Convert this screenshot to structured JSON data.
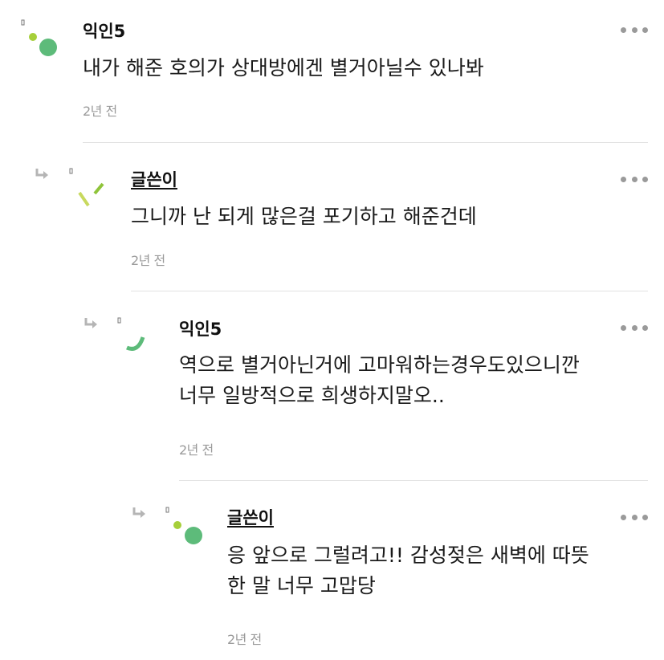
{
  "colors": {
    "accent_green": "#5dbb7a",
    "lime": "#a6cf3a",
    "text_primary": "#1a1a1a",
    "text_secondary": "#9a9a9a",
    "divider": "#e2e2e2"
  },
  "comments": [
    {
      "author": "익인5",
      "text": "내가 해준 호의가 상대방에겐 별거아닐수 있나봐",
      "time": "2년 전",
      "is_reply": false,
      "is_op": false,
      "avatar_icon": "dot-circle-avatar-icon"
    },
    {
      "author": "글쓴이",
      "text": "그니까 난 되게 많은걸 포기하고 해준건데",
      "time": "2년 전",
      "is_reply": true,
      "is_op": true,
      "avatar_icon": "slash-lines-avatar-icon"
    },
    {
      "author": "익인5",
      "text": "역으로 별거아닌거에 고마워하는경우도있으니깐\n너무 일방적으로 희생하지말오..",
      "time": "2년 전",
      "is_reply": true,
      "is_op": false,
      "avatar_icon": "arc-avatar-icon"
    },
    {
      "author": "글쓴이",
      "text": "응 앞으로 그럴려고!! 감성젖은 새벽에 따뜻\n한 말 너무 고맙당",
      "time": "2년 전",
      "is_reply": true,
      "is_op": true,
      "avatar_icon": "dot-circle-avatar-icon"
    }
  ],
  "more_menu_icon": "more-horizontal-icon",
  "reply_icon": "reply-arrow-icon"
}
